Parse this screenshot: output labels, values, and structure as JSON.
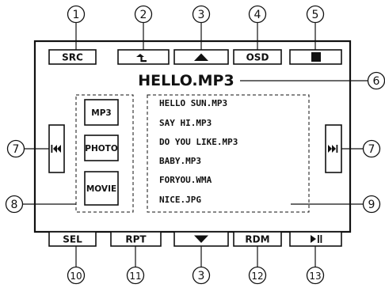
{
  "title": "HELLO.MP3",
  "top_buttons": {
    "src": "SRC",
    "osd": "OSD"
  },
  "bottom_buttons": {
    "sel": "SEL",
    "rpt": "RPT",
    "rdm": "RDM"
  },
  "mode_buttons": [
    "MP3",
    "PHOTO",
    "MOVIE"
  ],
  "files": [
    "HELLO SUN.MP3",
    "SAY HI.MP3",
    "DO YOU LIKE.MP3",
    "BABY.MP3",
    "FORYOU.WMA",
    "NICE.JPG"
  ],
  "callouts": {
    "c1": "1",
    "c2": "2",
    "c3_top": "3",
    "c4": "4",
    "c5": "5",
    "c6": "6",
    "c7_left": "7",
    "c7_right": "7",
    "c8": "8",
    "c9": "9",
    "c10": "10",
    "c11": "11",
    "c3_bottom": "3",
    "c12": "12",
    "c13": "13"
  },
  "icons": {
    "up_folder": "up-folder-icon",
    "up_arrow": "up-arrow-icon",
    "stop": "stop-icon",
    "prev": "previous-track-icon",
    "next": "next-track-icon",
    "down_arrow": "down-arrow-icon",
    "play_pause": "play-pause-icon"
  }
}
